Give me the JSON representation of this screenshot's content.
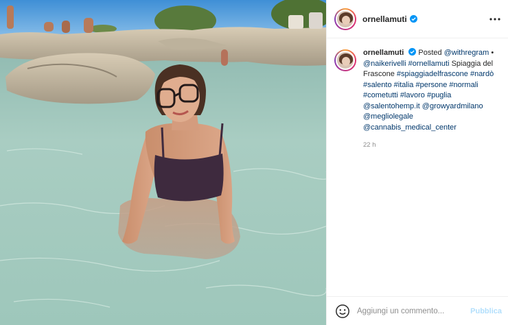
{
  "post": {
    "username": "ornellamuti",
    "more_icon": "more-horizontal-icon",
    "verified_color": "#0095f6"
  },
  "caption": {
    "username": "ornellamuti",
    "posted_text": "Posted",
    "posted_by": "@withregram",
    "separator": "•",
    "segments": [
      {
        "type": "link",
        "text": "@naikerivelli"
      },
      {
        "type": "text",
        "text": " "
      },
      {
        "type": "link",
        "text": "#ornellamuti"
      },
      {
        "type": "text",
        "text": " Spiaggia del Frascone "
      },
      {
        "type": "link",
        "text": "#spiaggiadelfrascone"
      },
      {
        "type": "text",
        "text": " "
      },
      {
        "type": "link",
        "text": "#nardò"
      },
      {
        "type": "text",
        "text": " "
      },
      {
        "type": "link",
        "text": "#salento"
      },
      {
        "type": "text",
        "text": " "
      },
      {
        "type": "link",
        "text": "#italia"
      },
      {
        "type": "text",
        "text": " "
      },
      {
        "type": "link",
        "text": "#persone"
      },
      {
        "type": "text",
        "text": " "
      },
      {
        "type": "link",
        "text": "#normali"
      },
      {
        "type": "text",
        "text": " "
      },
      {
        "type": "link",
        "text": "#cometutti"
      },
      {
        "type": "text",
        "text": " "
      },
      {
        "type": "link",
        "text": "#lavoro"
      },
      {
        "type": "text",
        "text": " "
      },
      {
        "type": "link",
        "text": "#puglia"
      },
      {
        "type": "text",
        "text": " "
      },
      {
        "type": "link",
        "text": "@salentohemp.it"
      },
      {
        "type": "text",
        "text": " "
      },
      {
        "type": "link",
        "text": "@growyardmilano"
      },
      {
        "type": "text",
        "text": " "
      },
      {
        "type": "link",
        "text": "@megliolegale"
      },
      {
        "type": "text",
        "text": " "
      },
      {
        "type": "link",
        "text": "@cannabis_medical_center"
      }
    ],
    "time": "22 h"
  },
  "comment": {
    "placeholder": "Aggiungi un commento...",
    "post_label": "Pubblica",
    "emoji_icon": "emoji-smiley-icon"
  },
  "colors": {
    "link": "#00376b",
    "muted": "#8e8e8e",
    "post_disabled": "#b2dffc"
  }
}
